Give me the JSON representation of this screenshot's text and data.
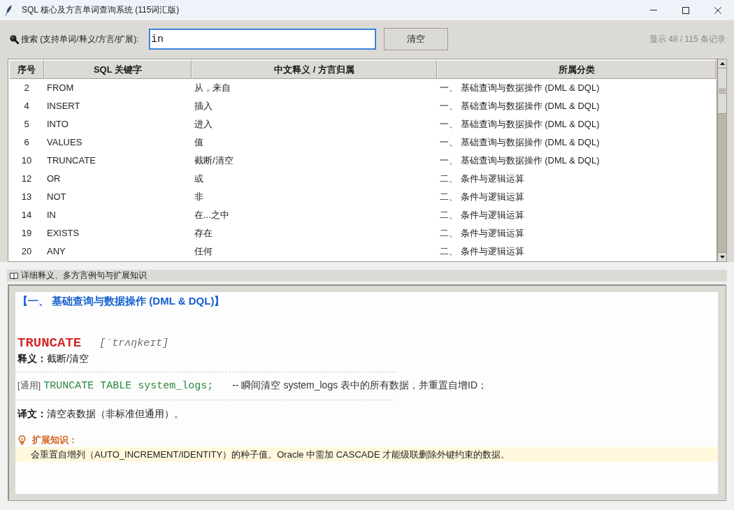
{
  "window": {
    "title": "SQL 核心及方言单词查询系统 (115词汇版)"
  },
  "search": {
    "label": "搜索 (支持单词/释义/方言/扩展):",
    "value": "in",
    "clear_button": "清空",
    "record_count": "显示 48 / 115 条记录"
  },
  "table": {
    "columns": [
      "序号",
      "SQL 关键字",
      "中文释义 / 方言归属",
      "所属分类"
    ],
    "rows": [
      {
        "cells": [
          "2",
          "FROM",
          "从，来自",
          "一、 基础查询与数据操作 (DML & DQL)"
        ],
        "selected": false
      },
      {
        "cells": [
          "4",
          "INSERT",
          "插入",
          "一、 基础查询与数据操作 (DML & DQL)"
        ],
        "selected": false
      },
      {
        "cells": [
          "5",
          "INTO",
          "进入",
          "一、 基础查询与数据操作 (DML & DQL)"
        ],
        "selected": false
      },
      {
        "cells": [
          "6",
          "VALUES",
          "值",
          "一、 基础查询与数据操作 (DML & DQL)"
        ],
        "selected": false
      },
      {
        "cells": [
          "10",
          "TRUNCATE",
          "截断/清空",
          "一、 基础查询与数据操作 (DML & DQL)"
        ],
        "selected": false
      },
      {
        "cells": [
          "12",
          "OR",
          "或",
          "二、 条件与逻辑运算"
        ],
        "selected": false
      },
      {
        "cells": [
          "13",
          "NOT",
          "非",
          "二、 条件与逻辑运算"
        ],
        "selected": false
      },
      {
        "cells": [
          "14",
          "IN",
          "在...之中",
          "二、 条件与逻辑运算"
        ],
        "selected": false
      },
      {
        "cells": [
          "19",
          "EXISTS",
          "存在",
          "二、 条件与逻辑运算"
        ],
        "selected": false
      },
      {
        "cells": [
          "20",
          "ANY",
          "任何",
          "二、 条件与逻辑运算"
        ],
        "selected": false
      }
    ]
  },
  "detail": {
    "title": "详细释义、多方言例句与扩展知识",
    "category_heading": "【一、 基础查询与数据操作 (DML & DQL)】",
    "word": "TRUNCATE",
    "phonetic": "[ˈtrʌŋkeɪt]",
    "meaning": "**释义：**截断/清空",
    "examples": [
      {
        "dialect": "[通用]",
        "code": "TRUNCATE TABLE system_logs;",
        "comment": "-- 瞬间清空 system_logs 表中的所有数据，并重置自增ID；"
      }
    ],
    "translation": "**译文：**清空表数据（非标准但通用）。",
    "extension_label": "扩展知识：",
    "extension": "会重置自增列（AUTO_INCREMENT/IDENTITY）的种子值。Oracle 中需加 CASCADE 才能级联删除外键约束的数据。"
  }
}
